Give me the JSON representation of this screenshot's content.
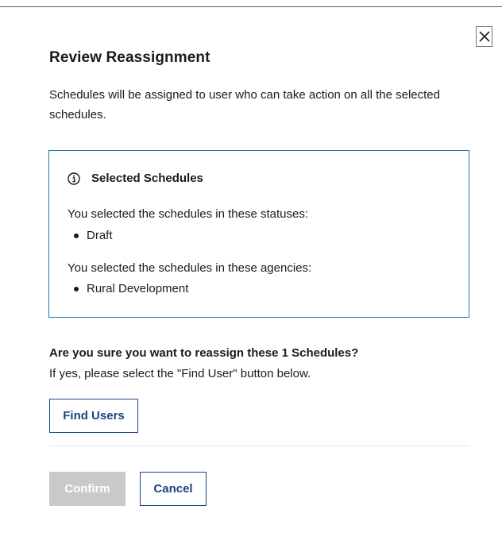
{
  "modal": {
    "close_icon": "close-icon",
    "title": "Review Reassignment",
    "intro": "Schedules will be assigned to user who can take action on all the selected schedules.",
    "info_box": {
      "icon": "info-icon",
      "heading": "Selected Schedules",
      "statuses_label": "You selected the schedules in these statuses:",
      "statuses": [
        "Draft"
      ],
      "agencies_label": "You selected the schedules in these agencies:",
      "agencies": [
        "Rural Development"
      ]
    },
    "question": "Are you sure you want to reassign these 1 Schedules?",
    "instruction": "If yes, please select the \"Find User\" button below.",
    "find_users_label": "Find Users",
    "confirm_label": "Confirm",
    "cancel_label": "Cancel"
  },
  "colors": {
    "primary": "#1a4480",
    "info_border": "#2378a8",
    "disabled_bg": "#c9c9c9",
    "text": "#1b1b1b",
    "divider": "#dfe1e2"
  }
}
